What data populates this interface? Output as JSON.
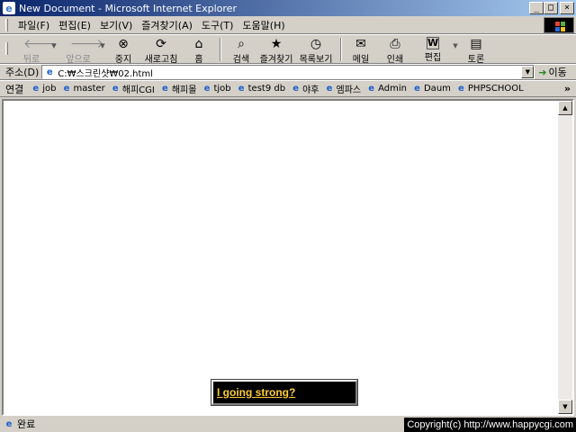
{
  "window": {
    "title": "New Document - Microsoft Internet Explorer",
    "min_symbol": "_",
    "max_symbol": "□",
    "close_symbol": "×"
  },
  "menu": {
    "items": [
      {
        "label": "파일(F)"
      },
      {
        "label": "편집(E)"
      },
      {
        "label": "보기(V)"
      },
      {
        "label": "즐겨찾기(A)"
      },
      {
        "label": "도구(T)"
      },
      {
        "label": "도움말(H)"
      }
    ]
  },
  "toolbar": {
    "back": {
      "label": "뒤로",
      "icon": "back-arrow-icon",
      "glyph": "🡐"
    },
    "forward": {
      "label": "앞으로",
      "icon": "forward-arrow-icon",
      "glyph": "🡒"
    },
    "stop": {
      "label": "중지",
      "icon": "stop-icon",
      "glyph": "⊗"
    },
    "refresh": {
      "label": "새로고침",
      "icon": "refresh-icon",
      "glyph": "⟳"
    },
    "home": {
      "label": "홈",
      "icon": "home-icon",
      "glyph": "⌂"
    },
    "search": {
      "label": "검색",
      "icon": "search-icon",
      "glyph": "⌕"
    },
    "favorites": {
      "label": "즐겨찾기",
      "icon": "favorites-icon",
      "glyph": "★"
    },
    "history": {
      "label": "목록보기",
      "icon": "history-icon",
      "glyph": "◷"
    },
    "mail": {
      "label": "메일",
      "icon": "mail-icon",
      "glyph": "✉"
    },
    "print": {
      "label": "인쇄",
      "icon": "print-icon",
      "glyph": "⎙"
    },
    "edit": {
      "label": "편집",
      "icon": "edit-icon",
      "glyph": "W"
    },
    "discuss": {
      "label": "토론",
      "icon": "discuss-icon",
      "glyph": "▤"
    }
  },
  "address": {
    "label": "주소(D)",
    "value": "C:₩스크린샷₩02.html",
    "go_label": "이동"
  },
  "links": {
    "label": "연결",
    "items": [
      "job",
      "master",
      "해피CGI",
      "해피몰",
      "tjob",
      "test9 db",
      "야후",
      "엠파스",
      "Admin",
      "Daum",
      "PHPSCHOOL"
    ],
    "more": "»"
  },
  "content": {
    "popup_link": "I going strong?"
  },
  "status": {
    "text": "완료",
    "copyright": "Copyright(c) http://www.happycgi.com"
  },
  "colors": {
    "title_start": "#0a246a",
    "title_end": "#a6caf0",
    "chrome": "#d4d0c8",
    "popup_bg": "#000000",
    "popup_link": "#ffcc33"
  }
}
